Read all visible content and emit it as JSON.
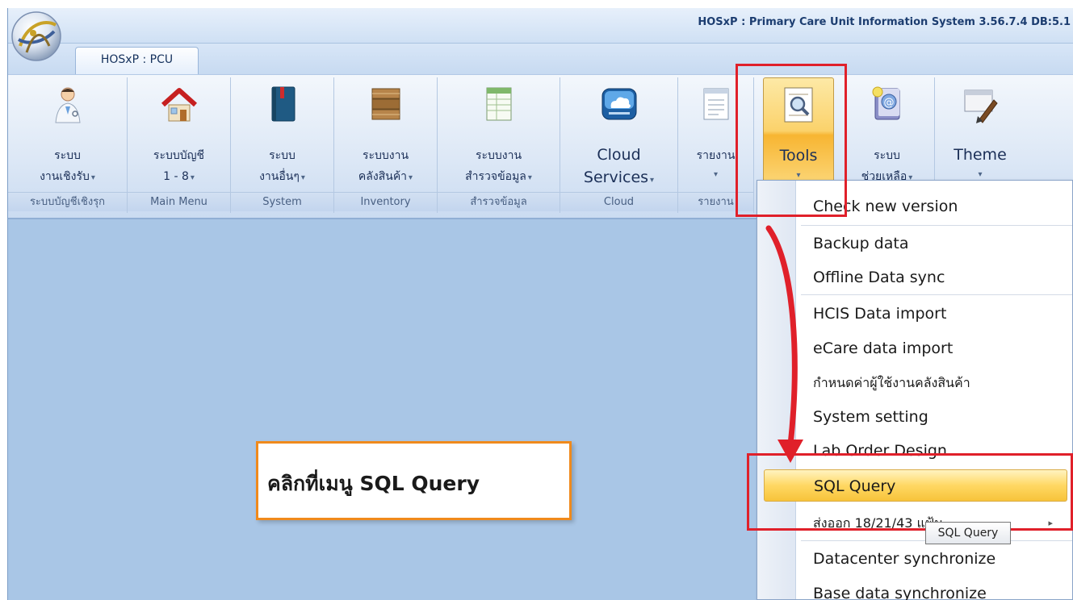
{
  "window": {
    "title": "HOSxP : Primary Care Unit Information System 3.56.7.4 DB:5.1"
  },
  "ribbon_tabs": [
    {
      "label": "HOSxP : PCU"
    }
  ],
  "ribbon_groups": [
    {
      "line1": "ระบบ",
      "line2": "งานเชิงรับ",
      "dropdown": "▾",
      "caption": "ระบบบัญชีเชิงรุก",
      "icon": "doctor-icon"
    },
    {
      "line1": "ระบบบัญชี",
      "line2": "1 - 8",
      "dropdown": "▾",
      "caption": "Main Menu",
      "icon": "house-icon"
    },
    {
      "line1": "ระบบ",
      "line2": "งานอื่นๆ",
      "dropdown": "▾",
      "caption": "System",
      "icon": "book-icon"
    },
    {
      "line1": "ระบบงาน",
      "line2": "คลังสินค้า",
      "dropdown": "▾",
      "caption": "Inventory",
      "icon": "boxes-icon"
    },
    {
      "line1": "ระบบงาน",
      "line2": "สำรวจข้อมูล",
      "dropdown": "▾",
      "caption": "สำรวจข้อมูล",
      "icon": "spreadsheet-icon"
    },
    {
      "line1": "Cloud",
      "line2": "Services",
      "dropdown": "▾",
      "caption": "Cloud",
      "icon": "cloud-icon"
    },
    {
      "line1": "รายงาน",
      "line2": "",
      "dropdown": "▾",
      "caption": "รายงาน",
      "icon": "report-icon"
    },
    {
      "line1": "Tools",
      "line2": "",
      "dropdown": "▾",
      "caption": "",
      "icon": "tools-icon"
    },
    {
      "line1": "ระบบ",
      "line2": "ช่วยเหลือ",
      "dropdown": "▾",
      "caption": "",
      "icon": "help-book-icon"
    },
    {
      "line1": "Theme",
      "line2": "",
      "dropdown": "▾",
      "caption": "",
      "icon": "theme-brush-icon"
    }
  ],
  "tools_menu": {
    "items": [
      {
        "label": "Check new version"
      },
      {
        "label": "Backup data"
      },
      {
        "label": "Offline Data sync"
      },
      {
        "label": "HCIS Data import"
      },
      {
        "label": "eCare data import"
      },
      {
        "label": "กำหนดค่าผู้ใช้งานคลังสินค้า"
      },
      {
        "label": "System setting"
      },
      {
        "label": "Lab Order Design"
      },
      {
        "label": "SQL Query",
        "selected": true
      },
      {
        "label": "ส่งออก 18/21/43 แฟ้ม",
        "has_submenu": true
      },
      {
        "label": "Datacenter synchronize"
      },
      {
        "label": "Base data synchronize"
      }
    ],
    "submenu_arrow": "▸"
  },
  "tooltip": {
    "text": "SQL Query"
  },
  "callout": {
    "text": "คลิกที่เมนู SQL Query"
  },
  "colors": {
    "workspace": "#a9c6e6",
    "highlight_red": "#e0202a",
    "callout_border": "#f08a1c",
    "menu_selected": "#ffd863"
  }
}
